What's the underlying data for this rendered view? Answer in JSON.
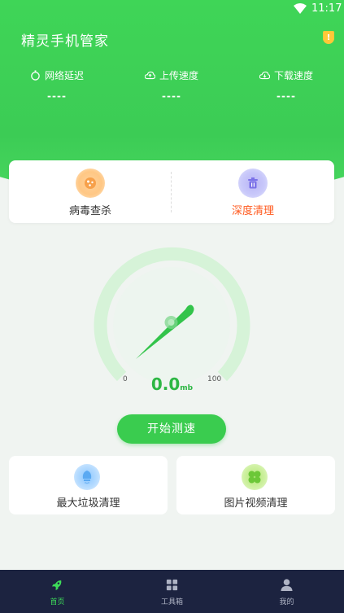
{
  "status_bar": {
    "time": "11:17"
  },
  "header": {
    "title": "精灵手机管家"
  },
  "metrics": [
    {
      "label": "网络延迟",
      "value": "----",
      "icon": "timer-icon"
    },
    {
      "label": "上传速度",
      "value": "----",
      "icon": "cloud-upload-icon"
    },
    {
      "label": "下载速度",
      "value": "----",
      "icon": "cloud-download-icon"
    }
  ],
  "actions": [
    {
      "label": "病毒查杀",
      "icon": "virus-icon"
    },
    {
      "label": "深度清理",
      "icon": "trash-icon"
    }
  ],
  "gauge": {
    "min_label": "0",
    "max_label": "100",
    "value": "0.0",
    "unit": "mb"
  },
  "start_button": {
    "label": "开始测速"
  },
  "features": [
    {
      "label": "最大垃圾清理",
      "icon": "brain-icon"
    },
    {
      "label": "图片视频清理",
      "icon": "clover-icon"
    }
  ],
  "nav": [
    {
      "label": "首页",
      "icon": "rocket-icon",
      "active": true
    },
    {
      "label": "工具箱",
      "icon": "grid-icon",
      "active": false
    },
    {
      "label": "我的",
      "icon": "person-icon",
      "active": false
    }
  ],
  "colors": {
    "brand_green": "#3acc4f",
    "warn_orange": "#ff5a1f",
    "nav_bg": "#1c2340"
  }
}
